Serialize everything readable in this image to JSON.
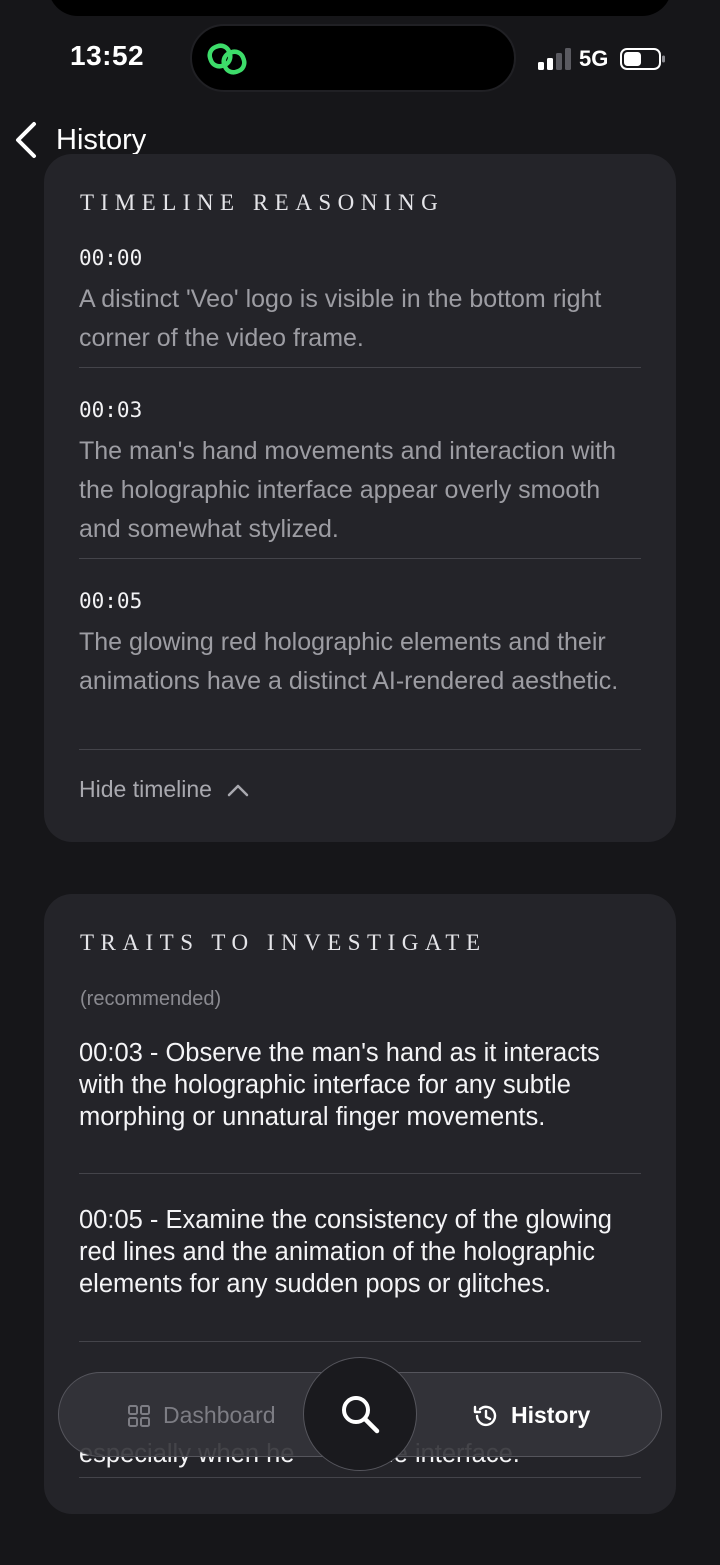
{
  "status_bar": {
    "time": "13:52",
    "network": "5G",
    "activity_icon": "link-icon",
    "activity_color": "#3ddc6a"
  },
  "nav": {
    "back_label": "History"
  },
  "timeline": {
    "title": "TIMELINE REASONING",
    "entries": [
      {
        "time": "00:00",
        "text": "A distinct 'Veo' logo is visible in the bottom right corner of the video frame."
      },
      {
        "time": "00:03",
        "text": "The man's hand movements and interaction with the holographic interface appear overly smooth and somewhat stylized."
      },
      {
        "time": "00:05",
        "text": "The glowing red holographic elements and their animations have a distinct AI-rendered aesthetic."
      }
    ],
    "toggle_label": "Hide timeline"
  },
  "traits": {
    "title": "TRAITS TO INVESTIGATE",
    "subtitle": "(recommended)",
    "items": [
      "00:03 - Observe the man's hand as it interacts with the holographic interface for any subtle morphing or unnatural finger movements.",
      "00:05 - Examine the consistency of the glowing red lines and the animation of the holographic elements for any sudden pops or glitches.",
      "especially when he       at the interface."
    ]
  },
  "tabbar": {
    "dashboard_label": "Dashboard",
    "history_label": "History"
  },
  "colors": {
    "background": "#161619",
    "card": "#242429",
    "accent_green": "#3ddc6a"
  }
}
